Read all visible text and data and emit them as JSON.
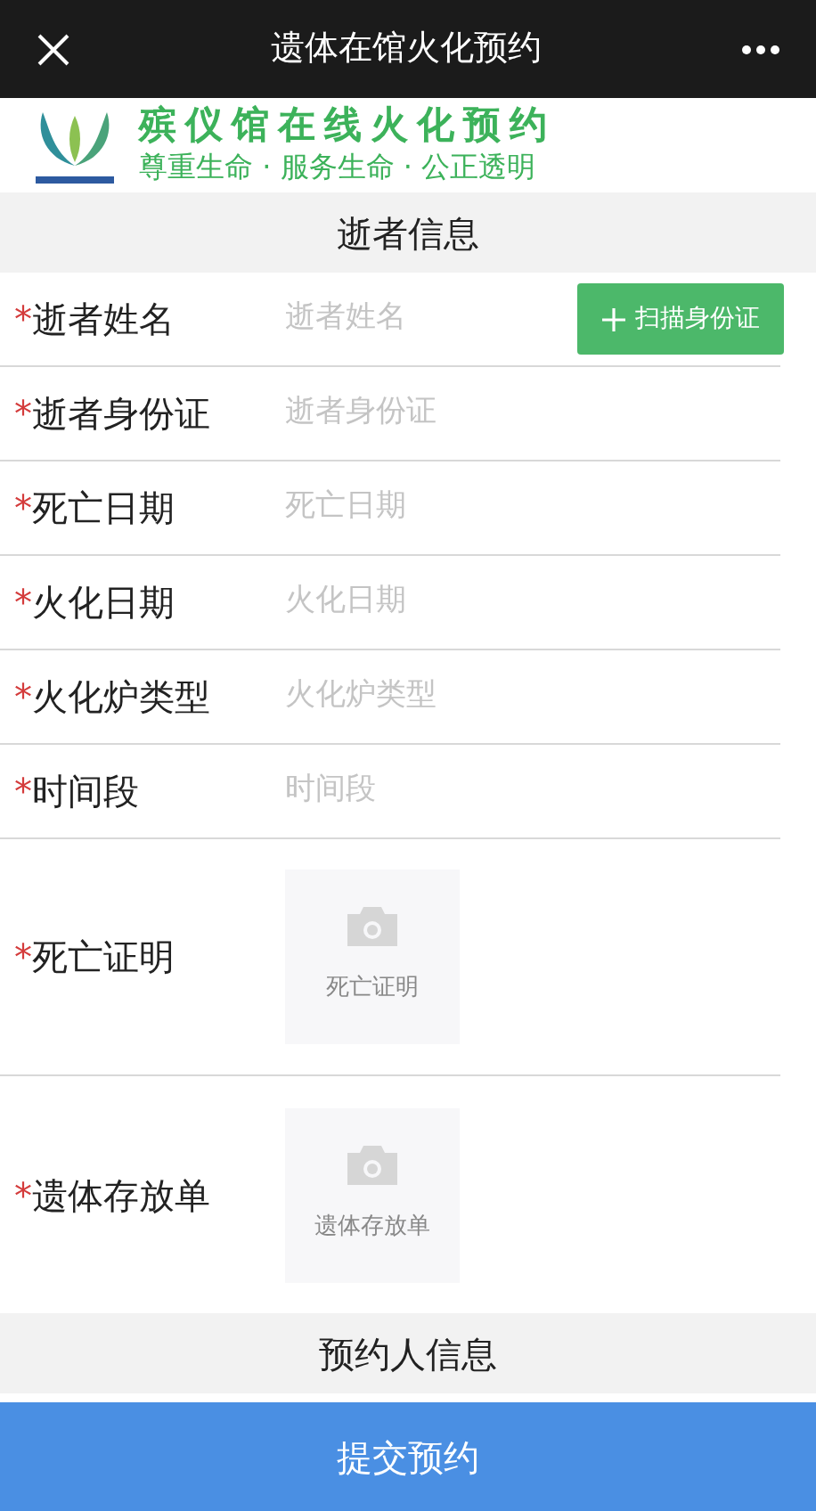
{
  "title_bar": {
    "title": "遗体在馆火化预约"
  },
  "banner": {
    "title": "殡仪馆在线火化预约",
    "slogan": "尊重生命 · 服务生命 · 公正透明"
  },
  "sections": [
    {
      "title": "逝者信息",
      "fields": [
        {
          "kind": "text",
          "mark": "*",
          "label": "逝者姓名",
          "placeholder": "逝者姓名",
          "button": "扫描身份证"
        },
        {
          "kind": "text",
          "mark": "*",
          "label": "逝者身份证",
          "placeholder": "逝者身份证"
        },
        {
          "kind": "text",
          "mark": "*",
          "label": "死亡日期",
          "placeholder": "死亡日期"
        },
        {
          "kind": "text",
          "mark": "*",
          "label": "火化日期",
          "placeholder": "火化日期"
        },
        {
          "kind": "text",
          "mark": "*",
          "label": "火化炉类型",
          "placeholder": "火化炉类型"
        },
        {
          "kind": "text",
          "mark": "*",
          "label": "时间段",
          "placeholder": "时间段"
        },
        {
          "kind": "photo",
          "mark": "*",
          "label": "死亡证明",
          "caption": "死亡证明"
        },
        {
          "kind": "photo",
          "mark": "*",
          "label": "遗体存放单",
          "caption": "遗体存放单"
        }
      ]
    },
    {
      "title": "预约人信息"
    }
  ],
  "submit": "提交预约"
}
